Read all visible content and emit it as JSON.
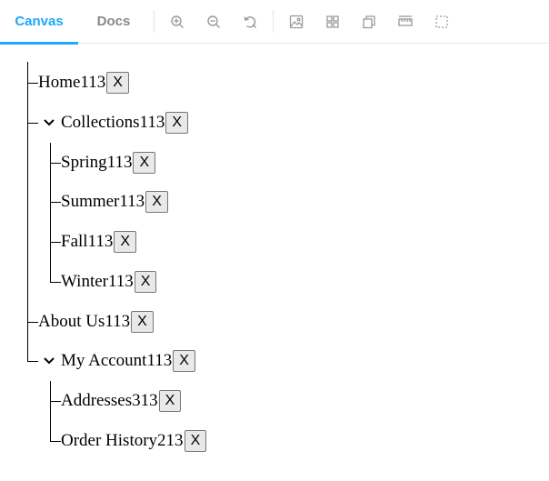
{
  "toolbar": {
    "tabs": [
      {
        "label": "Canvas",
        "active": true
      },
      {
        "label": "Docs",
        "active": false
      }
    ],
    "tools": [
      "zoom-in-icon",
      "zoom-out-icon",
      "reset-zoom-icon",
      "background-icon",
      "grid-icon",
      "viewport-icon",
      "measure-icon",
      "outline-icon"
    ],
    "accent_color": "#1ea7fd"
  },
  "tree": {
    "remove_label": "X",
    "nodes": [
      {
        "label": "Home113"
      },
      {
        "label": "Collections113",
        "expanded": true,
        "children": [
          {
            "label": "Spring113"
          },
          {
            "label": "Summer113"
          },
          {
            "label": "Fall113"
          },
          {
            "label": "Winter113"
          }
        ]
      },
      {
        "label": "About Us113"
      },
      {
        "label": "My Account113",
        "expanded": true,
        "children": [
          {
            "label": "Addresses313"
          },
          {
            "label": "Order History213"
          }
        ]
      }
    ]
  }
}
